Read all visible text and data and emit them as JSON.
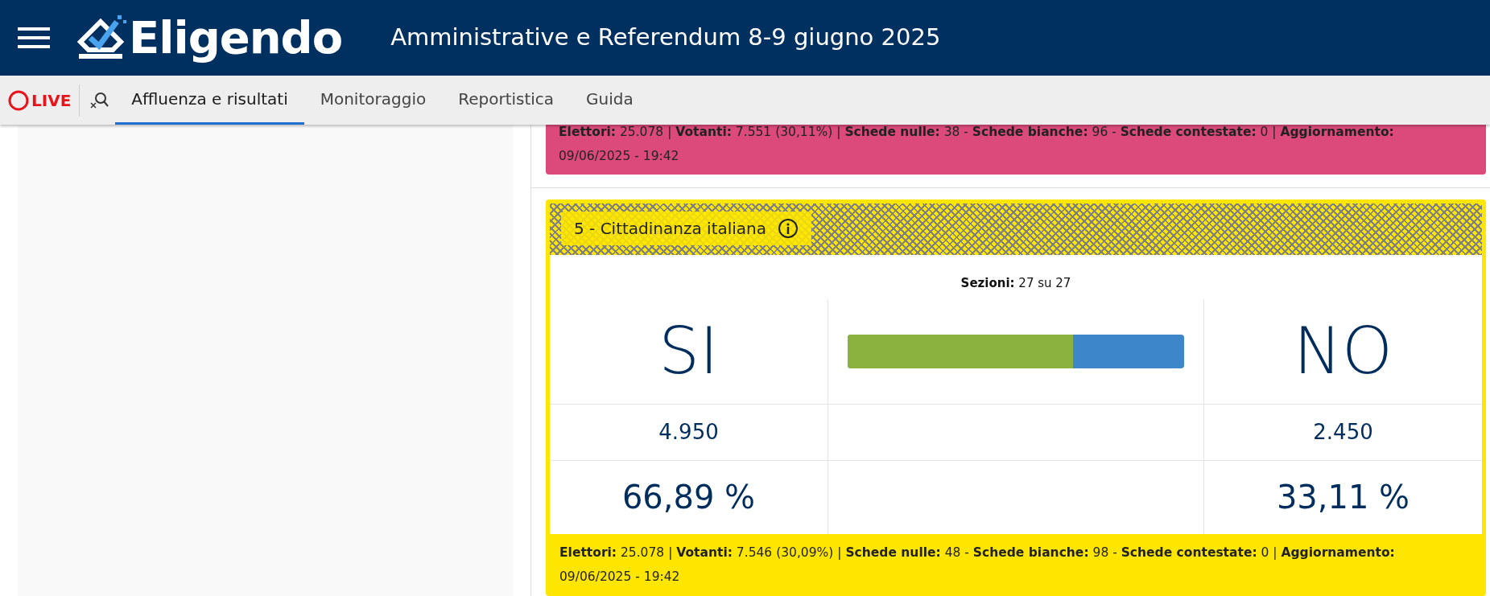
{
  "header": {
    "logo_text": "Eligendo",
    "title": "Amministrative e Referendum 8-9 giugno 2025"
  },
  "nav": {
    "live_label": "LIVE",
    "tabs": [
      {
        "label": "Affluenza e risultati",
        "selected": true
      },
      {
        "label": "Monitoraggio",
        "selected": false
      },
      {
        "label": "Reportistica",
        "selected": false
      },
      {
        "label": "Guida",
        "selected": false
      }
    ]
  },
  "referendums": [
    {
      "kind": "summary",
      "color": "#dc4a7c",
      "footer": "**Elettori:** 25.078 | **Votanti:** 7.551 (30,11%) | **Schede nulle:** 38 - **Schede bianche:** 96 - **Schede contestate:** 0 | **Aggiornamento:** 09/06/2025 - 19:42"
    },
    {
      "kind": "full",
      "color": "#ffe600",
      "title": "5 - Cittadinanza italiana",
      "sections": "**Sezioni:** 27 su 27",
      "yes_label": "SI",
      "no_label": "NO",
      "level": 0.6689,
      "yes_votes": "4.950",
      "no_votes": "2.450",
      "yes_percent": "66,89 %",
      "no_percent": "33,11 %",
      "footer": "**Elettori:** 25.078 | **Votanti:** 7.546 (30,09%) | **Schede nulle:** 48 - **Schede bianche:** 98 - **Schede contestate:** 0 | **Aggiornamento:** 09/06/2025 - 19:42"
    }
  ]
}
